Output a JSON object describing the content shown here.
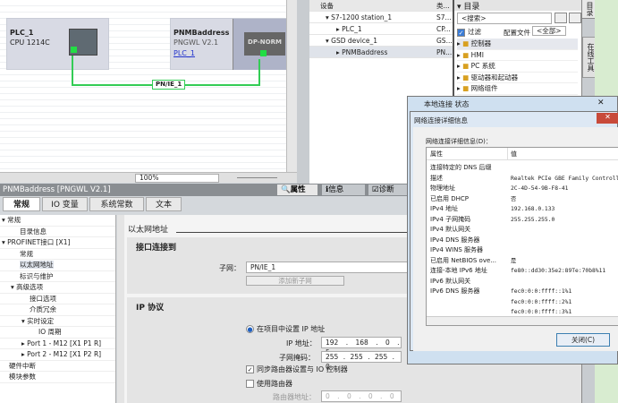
{
  "network_view": {
    "plc": {
      "name": "PLC_1",
      "type": "CPU 1214C"
    },
    "device": {
      "name": "PNMBaddress",
      "type": "PNGWL V2.1",
      "link": "PLC_1",
      "module": "DP-NORM"
    },
    "subnet": "PN/IE_1",
    "zoom": "100%"
  },
  "device_tree": {
    "col_device": "设备",
    "col_type": "类...",
    "rows": [
      {
        "label": "S7-1200 station_1",
        "type": "S7...",
        "expanded": true
      },
      {
        "label": "PLC_1",
        "type": "CP...",
        "expanded": false
      },
      {
        "label": "GSD device_1",
        "type": "GS...",
        "expanded": true
      },
      {
        "label": "PNMBaddress",
        "type": "PN...",
        "expanded": false
      }
    ]
  },
  "catalog": {
    "title": "目录",
    "search_placeholder": "<搜索>",
    "filter_label": "过滤",
    "profile_label": "配置文件",
    "profile_value": "<全部>",
    "items": [
      "控制器",
      "HMI",
      "PC 系统",
      "驱动器和起动器",
      "网络组件"
    ]
  },
  "side_tabs": [
    "目录",
    "在线工具"
  ],
  "inspector": {
    "title": "PNMBaddress [PNGWL V2.1]",
    "top_tabs": [
      "属性",
      "信息",
      "诊断"
    ],
    "tabs": [
      "常规",
      "IO 变量",
      "系统常数",
      "文本"
    ],
    "nav": [
      "常规",
      "目录信息",
      "PROFINET接口 [X1]",
      "常规",
      "以太网地址",
      "标识与维护",
      "高级选项",
      "接口选项",
      "介质冗余",
      "实时设定",
      "IO 周期",
      "Port 1 - M12 [X1 P1 R]",
      "Port 2 - M12 [X1 P2 R]",
      "硬件中断",
      "模块参数"
    ],
    "section": "以太网地址",
    "interface_heading": "接口连接到",
    "subnet_label": "子网：",
    "subnet_value": "PN/IE_1",
    "add_subnet": "添加新子网",
    "ip_heading": "IP 协议",
    "radio_label": "在项目中设置 IP 地址",
    "ip_label": "IP 地址：",
    "ip": [
      "192",
      "168",
      "0",
      "5"
    ],
    "mask_label": "子网掩码：",
    "mask": [
      "255",
      "255",
      "255",
      "0"
    ],
    "sync_label": "同步路由器设置与 IO 控制器",
    "use_router_label": "使用路由器",
    "router_label": "路由器地址：",
    "router": [
      "0",
      "0",
      "0",
      "0"
    ]
  },
  "status_dialog": {
    "title": "本地连接 状态"
  },
  "details_dialog": {
    "title": "网络连接详细信息",
    "list_label": "网络连接详细信息(D)：",
    "col_prop": "属性",
    "col_val": "值",
    "rows": [
      [
        "连接特定的 DNS 后缀",
        ""
      ],
      [
        "描述",
        "Realtek PCIe GBE Family Controll"
      ],
      [
        "物理地址",
        "2C-4D-54-9B-F8-41"
      ],
      [
        "已启用 DHCP",
        "否"
      ],
      [
        "IPv4 地址",
        "192.168.0.133"
      ],
      [
        "IPv4 子网掩码",
        "255.255.255.0"
      ],
      [
        "IPv4 默认网关",
        ""
      ],
      [
        "IPv4 DNS 服务器",
        ""
      ],
      [
        "IPv4 WINS 服务器",
        ""
      ],
      [
        "已启用 NetBIOS ove...",
        "是"
      ],
      [
        "连接-本地 IPv6 地址",
        "fe80::dd30:35e2:89Te:70b8%11"
      ],
      [
        "IPv6 默认网关",
        ""
      ],
      [
        "IPv6 DNS 服务器",
        "fec0:0:0:ffff::1%1"
      ],
      [
        "",
        "fec0:0:0:ffff::2%1"
      ],
      [
        "",
        "fec0:0:0:ffff::3%1"
      ]
    ],
    "close": "关闭(C)"
  }
}
